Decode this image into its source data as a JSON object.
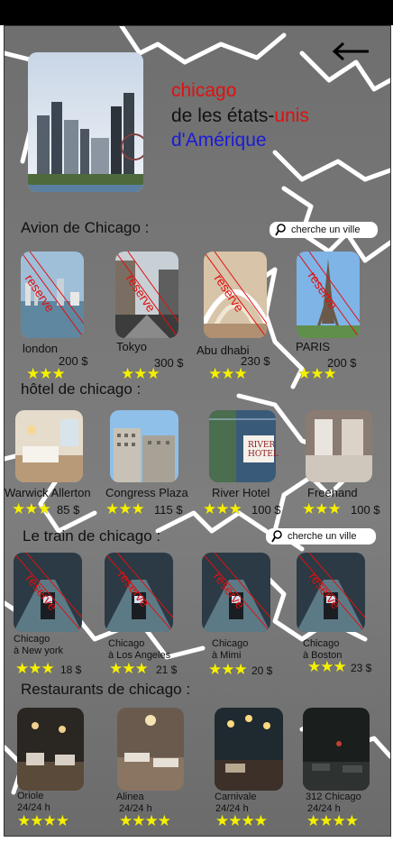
{
  "header": {
    "back_icon": "arrow-left-icon",
    "title_line1": "chicago",
    "title_line2a": "de les états-",
    "title_line2b": "unis",
    "title_line3": "d'Amérique",
    "colors": {
      "red": "#e01010",
      "blue": "#1a1ad8"
    }
  },
  "flights": {
    "title": "Avion de Chicago  :",
    "search_placeholder": "cherche un ville",
    "stamp": "reserve",
    "items": [
      {
        "name": "london",
        "price": "200 $",
        "stars": "★★★"
      },
      {
        "name": "Tokyo",
        "price": "300 $",
        "stars": "★★★"
      },
      {
        "name": "Abu dhabi",
        "price": "230 $",
        "stars": "★★★"
      },
      {
        "name": "PARIS",
        "price": "200 $",
        "stars": "★★★"
      }
    ]
  },
  "hotels": {
    "title": "hôtel de chicago :",
    "items": [
      {
        "name": "Warwick Allerton",
        "price": "85 $",
        "stars": "★★★"
      },
      {
        "name": "Congress Plaza",
        "price": "115 $",
        "stars": "★★★"
      },
      {
        "name": "River Hotel",
        "price": "100 $",
        "stars": "★★★"
      },
      {
        "name": "Freehand",
        "price": "100 $",
        "stars": "★★★"
      }
    ],
    "sign_text": "RIVER HOTEL"
  },
  "trains": {
    "title": "Le train de chicago :",
    "search_placeholder": "cherche un ville",
    "stamp": "reserve",
    "items": [
      {
        "line1": "Chicago",
        "line2": "à New york",
        "price": "18 $",
        "stars": "★★★"
      },
      {
        "line1": "Chicago",
        "line2": "à Los Angeles",
        "price": "21 $",
        "stars": "★★★"
      },
      {
        "line1": "Chicago",
        "line2": "à Mimi",
        "price": "20 $",
        "stars": "★★★"
      },
      {
        "line1": "Chicago",
        "line2": "à Boston",
        "price": "23 $",
        "stars": "★★★"
      }
    ]
  },
  "restaurants": {
    "title": "Restaurants de chicago :",
    "items": [
      {
        "name": "Oriole",
        "hours": "24/24 h",
        "stars": "★★★★"
      },
      {
        "name": "Alinea",
        "hours": "24/24 h",
        "stars": "★★★★"
      },
      {
        "name": "Carnivale",
        "hours": "24/24 h",
        "stars": "★★★★"
      },
      {
        "name": "312 Chicago",
        "hours": "24/24 h",
        "stars": "★★★★"
      }
    ]
  }
}
